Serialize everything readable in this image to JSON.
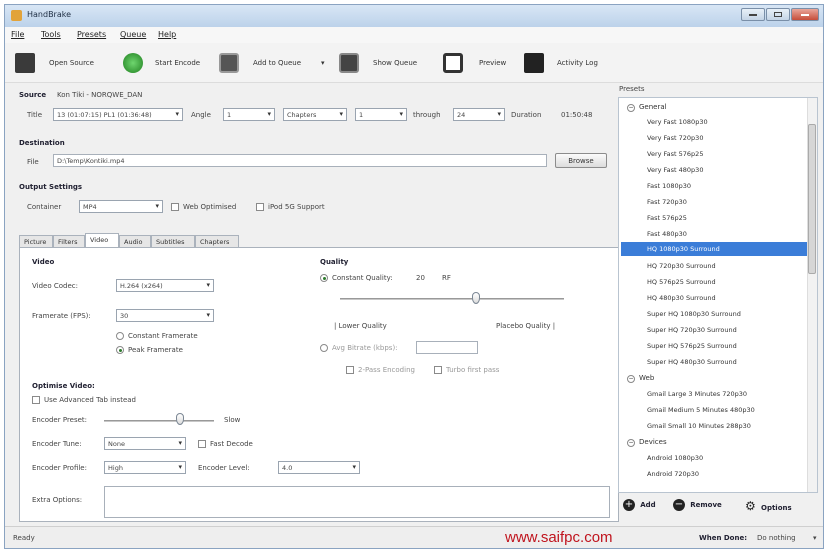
{
  "window": {
    "title": "HandBrake"
  },
  "menu": [
    "File",
    "Tools",
    "Presets",
    "Queue",
    "Help"
  ],
  "toolbar": {
    "open_source": "Open Source",
    "start_encode": "Start Encode",
    "add_to_queue": "Add to Queue",
    "show_queue": "Show Queue",
    "preview": "Preview",
    "activity_log": "Activity Log"
  },
  "source": {
    "label": "Source",
    "value": "Kon Tiki - NORQWE_DAN",
    "title_label": "Title",
    "title_value": "13 (01:07:15) PL1 (01:36:48)",
    "angle_label": "Angle",
    "angle_value": "1",
    "range_type": "Chapters",
    "range_start": "1",
    "through_label": "through",
    "range_end": "24",
    "duration_label": "Duration",
    "duration_value": "01:50:48"
  },
  "destination": {
    "label": "Destination",
    "file_label": "File",
    "file_value": "D:\\Temp\\Kontiki.mp4",
    "browse": "Browse"
  },
  "output": {
    "label": "Output Settings",
    "container_label": "Container",
    "container_value": "MP4",
    "web_optimised": "Web Optimised",
    "ipod_support": "iPod 5G Support"
  },
  "tabs": [
    "Picture",
    "Filters",
    "Video",
    "Audio",
    "Subtitles",
    "Chapters"
  ],
  "video": {
    "heading": "Video",
    "codec_label": "Video Codec:",
    "codec_value": "H.264 (x264)",
    "fps_label": "Framerate (FPS):",
    "fps_value": "30",
    "constant_framerate": "Constant Framerate",
    "peak_framerate": "Peak Framerate",
    "quality_heading": "Quality",
    "constant_quality": "Constant Quality:",
    "rf_value": "20",
    "rf_label": "RF",
    "lower_quality": "| Lower Quality",
    "placebo_quality": "Placebo Quality |",
    "avg_bitrate": "Avg Bitrate (kbps):",
    "two_pass": "2-Pass Encoding",
    "turbo_first": "Turbo first pass"
  },
  "optimise": {
    "heading": "Optimise Video:",
    "advanced_tab": "Use Advanced Tab instead",
    "preset_label": "Encoder Preset:",
    "preset_end": "Slow",
    "tune_label": "Encoder Tune:",
    "tune_value": "None",
    "fast_decode": "Fast Decode",
    "profile_label": "Encoder Profile:",
    "profile_value": "High",
    "level_label": "Encoder Level:",
    "level_value": "4.0",
    "extra_label": "Extra Options:"
  },
  "presets": {
    "label": "Presets",
    "groups": [
      {
        "name": "General",
        "items": [
          "Very Fast 1080p30",
          "Very Fast 720p30",
          "Very Fast 576p25",
          "Very Fast 480p30",
          "Fast 1080p30",
          "Fast 720p30",
          "Fast 576p25",
          "Fast 480p30",
          "HQ 1080p30 Surround",
          "HQ 720p30 Surround",
          "HQ 576p25 Surround",
          "HQ 480p30 Surround",
          "Super HQ 1080p30 Surround",
          "Super HQ 720p30 Surround",
          "Super HQ 576p25 Surround",
          "Super HQ 480p30 Surround"
        ]
      },
      {
        "name": "Web",
        "items": [
          "Gmail Large 3 Minutes 720p30",
          "Gmail Medium 5 Minutes 480p30",
          "Gmail Small 10 Minutes 288p30"
        ]
      },
      {
        "name": "Devices",
        "items": [
          "Android 1080p30",
          "Android 720p30"
        ]
      }
    ],
    "selected": "HQ 1080p30 Surround",
    "add": "Add",
    "remove": "Remove",
    "options": "Options"
  },
  "status": {
    "text": "Ready",
    "watermark": "www.saifpc.com",
    "when_done_label": "When Done:",
    "when_done_value": "Do nothing"
  },
  "colors": {
    "accent": "#3b7dd8",
    "watermark": "#c0141e",
    "start": "#2f9a2f"
  }
}
